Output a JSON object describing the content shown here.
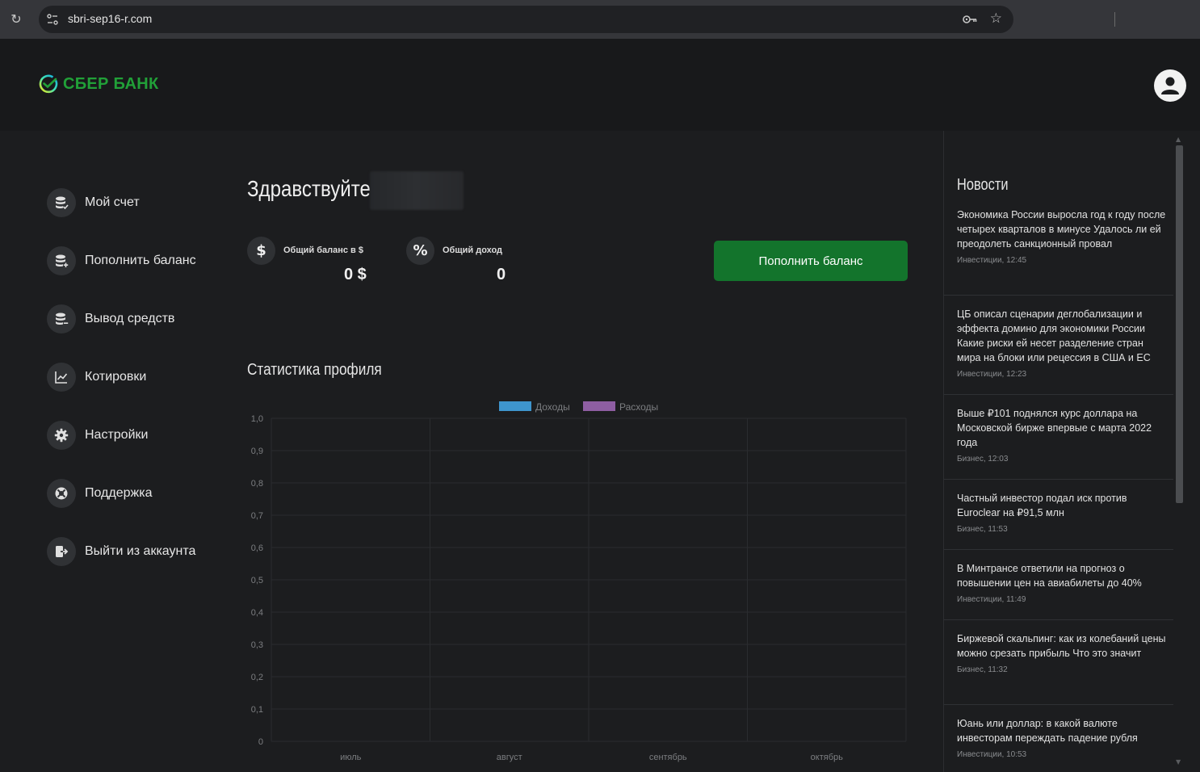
{
  "browser": {
    "url": "sbri-sep16-r.com"
  },
  "header": {
    "logo_text": "СБЕР БАНК",
    "brand_color": "#21a038"
  },
  "sidebar": {
    "items": [
      {
        "label": "Мой счет",
        "icon": "database-check-icon"
      },
      {
        "label": "Пополнить баланс",
        "icon": "database-plus-icon"
      },
      {
        "label": "Вывод средств",
        "icon": "database-minus-icon"
      },
      {
        "label": "Котировки",
        "icon": "chart-line-icon"
      },
      {
        "label": "Настройки",
        "icon": "gear-icon"
      },
      {
        "label": "Поддержка",
        "icon": "lifebuoy-icon"
      },
      {
        "label": "Выйти из аккаунта",
        "icon": "logout-icon"
      }
    ]
  },
  "main": {
    "greeting": "Здравствуйте,",
    "balance": {
      "icon_glyph": "$",
      "label": "Общий баланс в $",
      "value": "0 $"
    },
    "income": {
      "icon_glyph": "%",
      "label": "Общий доход",
      "value": "0"
    },
    "topup_button": "Пополнить баланс",
    "stats_title": "Статистика профиля"
  },
  "chart_data": {
    "type": "bar",
    "categories": [
      "июль",
      "август",
      "сентябрь",
      "октябрь"
    ],
    "series": [
      {
        "name": "Доходы",
        "color": "#3e95cd",
        "values": [
          0,
          0,
          0,
          0
        ]
      },
      {
        "name": "Расходы",
        "color": "#8e5ea2",
        "values": [
          0,
          0,
          0,
          0
        ]
      }
    ],
    "ylim": [
      0,
      1.0
    ],
    "yticks": [
      "0",
      "0,1",
      "0,2",
      "0,3",
      "0,4",
      "0,5",
      "0,6",
      "0,7",
      "0,8",
      "0,9",
      "1,0"
    ],
    "legend": "top",
    "grid": true
  },
  "news": {
    "title": "Новости",
    "items": [
      {
        "text": "Экономика России выросла год к году после четырех кварталов в минусе Удалось ли ей преодолеть санкционный провал",
        "meta": "Инвестиции, 12:45"
      },
      {
        "text": "ЦБ описал сценарии деглобализации и эффекта домино для экономики России Какие риски ей несет разделение стран мира на блоки или рецессия в США и ЕС",
        "meta": "Инвестиции, 12:23"
      },
      {
        "text": "Выше ₽101 поднялся курс доллара на Московской бирже впервые с марта 2022 года",
        "meta": "Бизнес, 12:03"
      },
      {
        "text": "Частный инвестор подал иск против Euroclear на ₽91,5 млн",
        "meta": "Бизнес, 11:53"
      },
      {
        "text": "В Минтрансе ответили на прогноз о повышении цен на авиабилеты до 40%",
        "meta": "Инвестиции, 11:49"
      },
      {
        "text": "Биржевой скальпинг: как из колебаний цены можно срезать прибыль Что это значит",
        "meta": "Бизнес, 11:32"
      },
      {
        "text": "Юань или доллар: в какой валюте инвесторам переждать падение рубля",
        "meta": "Инвестиции, 10:53"
      }
    ]
  }
}
